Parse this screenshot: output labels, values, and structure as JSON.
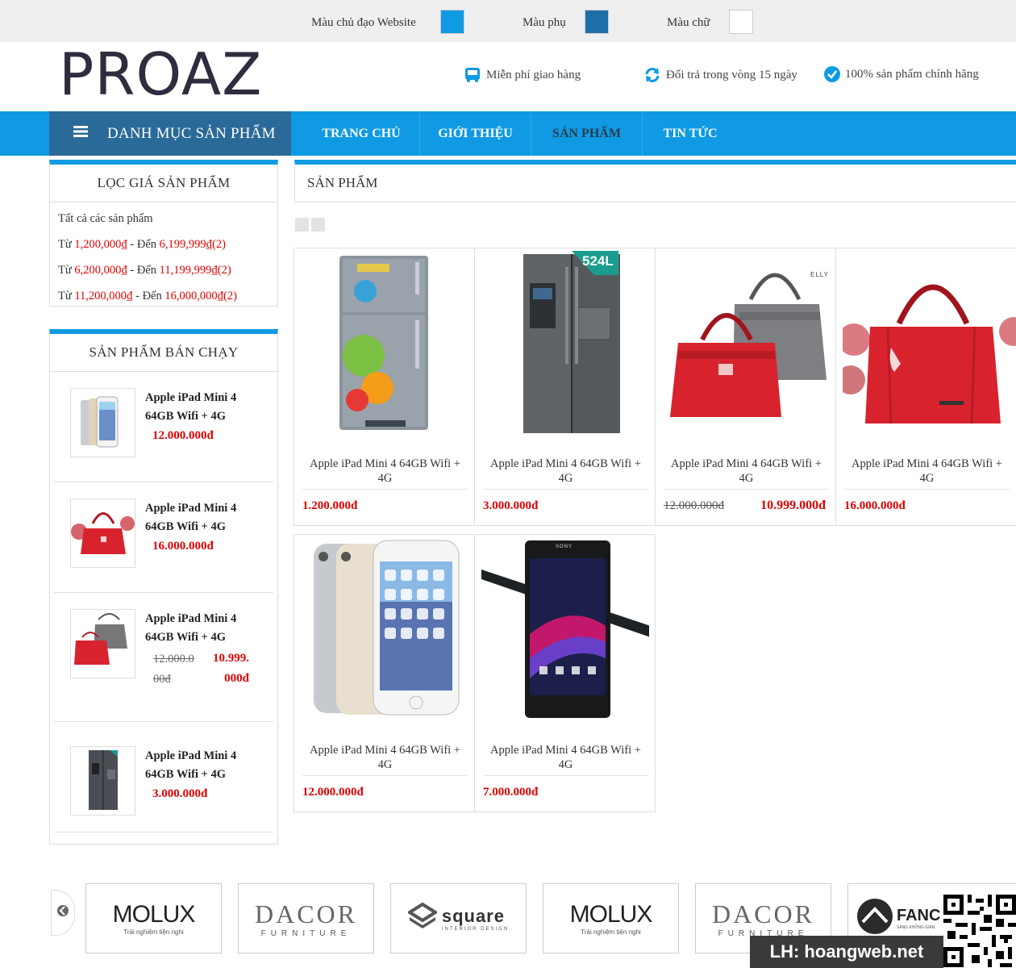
{
  "topbar": {
    "main_color_label": "Màu chủ đạo Website",
    "secondary_color_label": "Màu phụ",
    "text_color_label": "Màu chữ",
    "main_color": "#0f9ae3",
    "secondary_color": "#1e6ea8",
    "text_color": "#ffffff"
  },
  "header": {
    "logo": "PROAZ",
    "features": [
      {
        "icon": "bus-icon",
        "label": "Miễn phí giao hàng"
      },
      {
        "icon": "refresh-icon",
        "label": "Đổi trả trong vòng 15 ngày"
      },
      {
        "icon": "check-circle-icon",
        "label": "100% sản phẩm chính hãng"
      }
    ]
  },
  "nav": {
    "category_label": "DANH MỤC SẢN PHẨM",
    "items": [
      "TRANG CHỦ",
      "GIỚI THIỆU",
      "SẢN PHẨM",
      "TIN TỨC"
    ],
    "active": "SẢN PHẨM"
  },
  "price_filter": {
    "title": "LỌC GIÁ SẢN PHẨM",
    "all_label": "Tất cả các sản phẩm",
    "ranges": [
      {
        "from_word": "Từ",
        "from": "1,200,000₫",
        "to_word": "- Đến",
        "to": "6,199,999₫(2)"
      },
      {
        "from_word": "Từ",
        "from": "6,200,000₫",
        "to_word": "- Đến",
        "to": "11,199,999₫(2)"
      },
      {
        "from_word": "Từ",
        "from": "11,200,000₫",
        "to_word": "- Đến",
        "to": "16,000,000₫(2)"
      }
    ]
  },
  "bestsellers": {
    "title": "SẢN PHẨM BÁN CHẠY",
    "items": [
      {
        "name_line1": "Apple iPad Mini 4",
        "name_line2": "64GB Wifi + 4G",
        "price": "12.000.000đ"
      },
      {
        "name_line1": "Apple iPad Mini 4",
        "name_line2": "64GB Wifi + 4G",
        "price": "16.000.000đ"
      },
      {
        "name_line1": "Apple iPad Mini 4",
        "name_line2": "64GB Wifi + 4G",
        "old_price_line1": "12.000.0",
        "old_price_line2": "00đ",
        "price_line1": "10.999.",
        "price_line2": "000đ"
      },
      {
        "name_line1": "Apple iPad Mini 4",
        "name_line2": "64GB Wifi + 4G",
        "price": "3.000.000đ"
      }
    ]
  },
  "main": {
    "title": "SẢN PHẨM",
    "products": [
      {
        "name": "Apple iPad Mini 4 64GB Wifi + 4G",
        "price": "1.200.000đ",
        "image": "fridge-icon"
      },
      {
        "name": "Apple iPad Mini 4 64GB Wifi + 4G",
        "price": "3.000.000đ",
        "image": "side-by-side-fridge",
        "badge": "524L"
      },
      {
        "name": "Apple iPad Mini 4 64GB Wifi + 4G",
        "old_price": "12.000.000đ",
        "price": "10.999.000đ",
        "image": "handbags",
        "brand_mark": "ELLY"
      },
      {
        "name": "Apple iPad Mini 4 64GB Wifi + 4G",
        "price": "16.000.000đ",
        "image": "red-handbag"
      },
      {
        "name": "Apple iPad Mini 4 64GB Wifi + 4G",
        "price": "12.000.000đ",
        "image": "iphone"
      },
      {
        "name": "Apple iPad Mini 4 64GB Wifi + 4G",
        "price": "7.000.000đ",
        "image": "sony-phone",
        "brand_mark": "SONY"
      }
    ]
  },
  "brands": [
    {
      "name": "MOLUX",
      "tagline": "Trải nghiệm tiện nghi"
    },
    {
      "name": "DACOR",
      "tagline": "FURNITURE"
    },
    {
      "name": "square",
      "tagline": "INTERIOR DESIGN"
    },
    {
      "name": "MOLUX",
      "tagline": "Trải nghiệm tiện nghi"
    },
    {
      "name": "DACOR",
      "tagline": "FURNITURE"
    },
    {
      "name": "FANC",
      "tagline": "SÁNG KHÔNG GIAN"
    }
  ],
  "watermark": "LH: hoangweb.net"
}
